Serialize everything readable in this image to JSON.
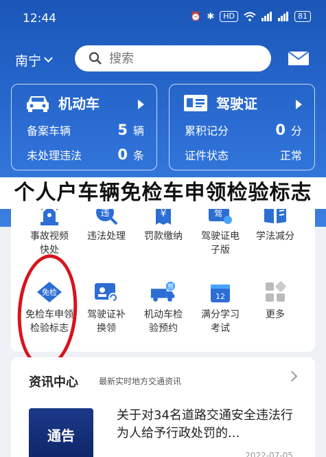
{
  "status": {
    "time": "12:44",
    "battery": "81",
    "hd_label": "HD"
  },
  "header": {
    "city": "南宁",
    "search_placeholder": "搜索"
  },
  "cards": {
    "vehicle": {
      "title": "机动车",
      "row1_label": "备案车辆",
      "row1_value": "5",
      "row1_unit": "辆",
      "row2_label": "未处理违法",
      "row2_value": "0",
      "row2_unit": "条"
    },
    "license": {
      "title": "驾驶证",
      "row1_label": "累积记分",
      "row1_value": "0",
      "row1_unit": "分",
      "row2_label": "证件状态",
      "row2_value": "正常"
    }
  },
  "overlay_caption": "个人户车辆免检车申领检验标志",
  "services": [
    {
      "line1": "事故视频",
      "line2": "快处"
    },
    {
      "line1": "违法处理",
      "line2": ""
    },
    {
      "line1": "罚款缴纳",
      "line2": ""
    },
    {
      "line1": "驾驶证电",
      "line2": "子版"
    },
    {
      "line1": "学法减分",
      "line2": ""
    },
    {
      "line1": "免检车申领",
      "line2": "检验标志",
      "icon_text": "免检"
    },
    {
      "line1": "驾驶证补",
      "line2": "换领"
    },
    {
      "line1": "机动车检",
      "line2": "验预约",
      "icon_text": "预"
    },
    {
      "line1": "满分学习",
      "line2": "考试",
      "icon_text": "12"
    },
    {
      "line1": "更多",
      "line2": ""
    }
  ],
  "icon_labels": {
    "violation": "违",
    "fine": "¥",
    "elicense": "驾"
  },
  "news": {
    "title": "资讯中心",
    "subtitle": "最新实时地方交通资讯",
    "thumb_text": "通告",
    "headline": "关于对34名道路交通安全违法行为人给予行政处罚的...",
    "date": "2022-07-05"
  },
  "colors": {
    "primary": "#2c6ed4",
    "accent_red": "#d8141d"
  }
}
